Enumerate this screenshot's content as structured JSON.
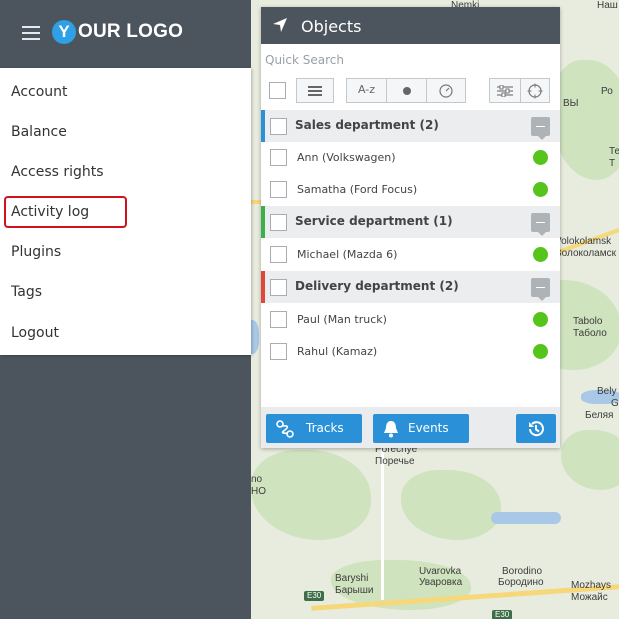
{
  "brand": {
    "logo_letter": "Y",
    "logo_text": "OUR LOGO",
    "accent": "#2f9fe6"
  },
  "menu": {
    "items": [
      {
        "label": "Account"
      },
      {
        "label": "Balance"
      },
      {
        "label": "Access rights"
      },
      {
        "label": "Activity log",
        "highlighted": true
      },
      {
        "label": "Plugins"
      },
      {
        "label": "Tags"
      },
      {
        "label": "Logout"
      }
    ]
  },
  "objects_panel": {
    "title": "Objects",
    "search_placeholder": "Quick Search",
    "sort_label": "A-z",
    "groups": [
      {
        "label": "Sales department (2)",
        "color": "#2a91d8",
        "items": [
          {
            "label": "Ann (Volkswagen)",
            "status": "online"
          },
          {
            "label": "Samatha (Ford Focus)",
            "status": "online"
          }
        ]
      },
      {
        "label": "Service department (1)",
        "color": "#3cae4a",
        "items": [
          {
            "label": "Michael (Mazda 6)",
            "status": "online"
          }
        ]
      },
      {
        "label": "Delivery department (2)",
        "color": "#e0463c",
        "items": [
          {
            "label": "Paul (Man truck)",
            "status": "online"
          },
          {
            "label": "Rahul (Kamaz)",
            "status": "online"
          }
        ]
      }
    ],
    "footer": {
      "tracks_label": "Tracks",
      "events_label": "Events"
    }
  },
  "map": {
    "labels": {
      "nemki": "Nemki",
      "nash": "Наш",
      "ro": "Ро",
      "vy": "ВЫ",
      "te": "Те",
      "t": "Т",
      "volokolamsk": "Volokolamsk",
      "volokolamsk_ru": "Волоколамск",
      "tabolo": "Tabolo",
      "tabolo_ru": "Таболо",
      "bely": "Bely",
      "g": "G",
      "belya_ru": "Беляя",
      "porechye_en": "Porechye",
      "porechye_ru": "Поречье",
      "uvarovka": "Uvarovka",
      "uvarovka_ru": "Уваровка",
      "borodino": "Borodino",
      "borodino_ru": "Бородино",
      "baryshi": "Baryshi",
      "baryshi_ru": "Барыши",
      "mozhays": "Mozhays",
      "mozhays_ru": "Можайс",
      "no": "no",
      "hno": "НО"
    },
    "shields": {
      "e30_a": "E30",
      "e30_b": "E30"
    }
  }
}
